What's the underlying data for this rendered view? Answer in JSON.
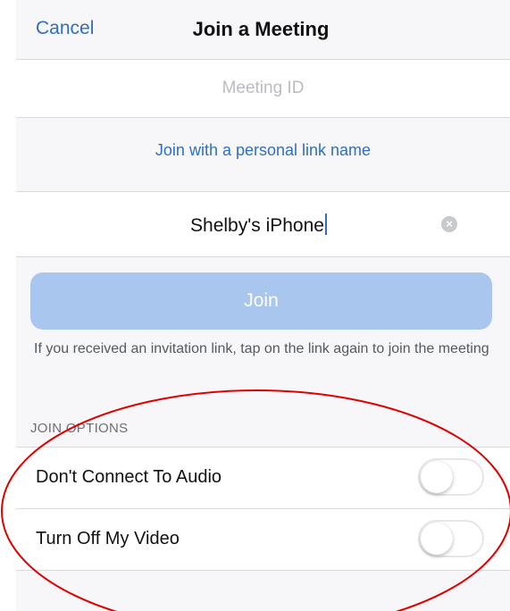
{
  "navbar": {
    "cancel_label": "Cancel",
    "title": "Join a Meeting"
  },
  "meeting_id": {
    "placeholder": "Meeting ID",
    "value": ""
  },
  "personal_link_label": "Join with a personal link name",
  "display_name": {
    "value": "Shelby's iPhone"
  },
  "join_button_label": "Join",
  "hint_text": "If you received an invitation link, tap on the link again to join the meeting",
  "join_options": {
    "header": "JOIN OPTIONS",
    "items": [
      {
        "label": "Don't Connect To Audio",
        "enabled": false
      },
      {
        "label": "Turn Off My Video",
        "enabled": false
      }
    ]
  },
  "colors": {
    "accent": "#2f6fbe",
    "join_button_disabled": "#a9c6ef",
    "annotation_circle": "#e00000"
  }
}
